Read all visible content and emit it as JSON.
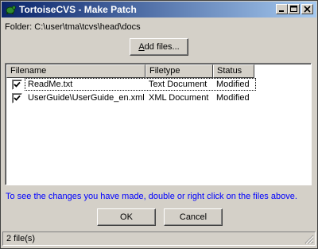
{
  "window": {
    "title": "TortoiseCVS - Make Patch"
  },
  "folder_label": "Folder: C:\\user\\tma\\tcvs\\head\\docs",
  "add_files": {
    "underlined": "A",
    "rest": "dd files..."
  },
  "file_list": {
    "columns": [
      "Filename",
      "Filetype",
      "Status"
    ],
    "rows": [
      {
        "checked": true,
        "filename": "ReadMe.txt",
        "filetype": "Text Document",
        "status": "Modified"
      },
      {
        "checked": true,
        "filename": "UserGuide\\UserGuide_en.xml",
        "filetype": "XML Document",
        "status": "Modified"
      }
    ]
  },
  "hint_text": "To see the changes you have made, double or right click on the files above.",
  "buttons": {
    "ok": "OK",
    "cancel": "Cancel"
  },
  "status_bar": {
    "text": "2 file(s)"
  },
  "colors": {
    "title_start": "#0a246a",
    "title_end": "#a6caf0",
    "face": "#d4d0c8",
    "hint": "#0000ff"
  },
  "icons": [
    "tortoise-app-icon",
    "minimize-icon",
    "maximize-icon",
    "close-icon",
    "checkmark-icon",
    "size-grip-icon"
  ]
}
